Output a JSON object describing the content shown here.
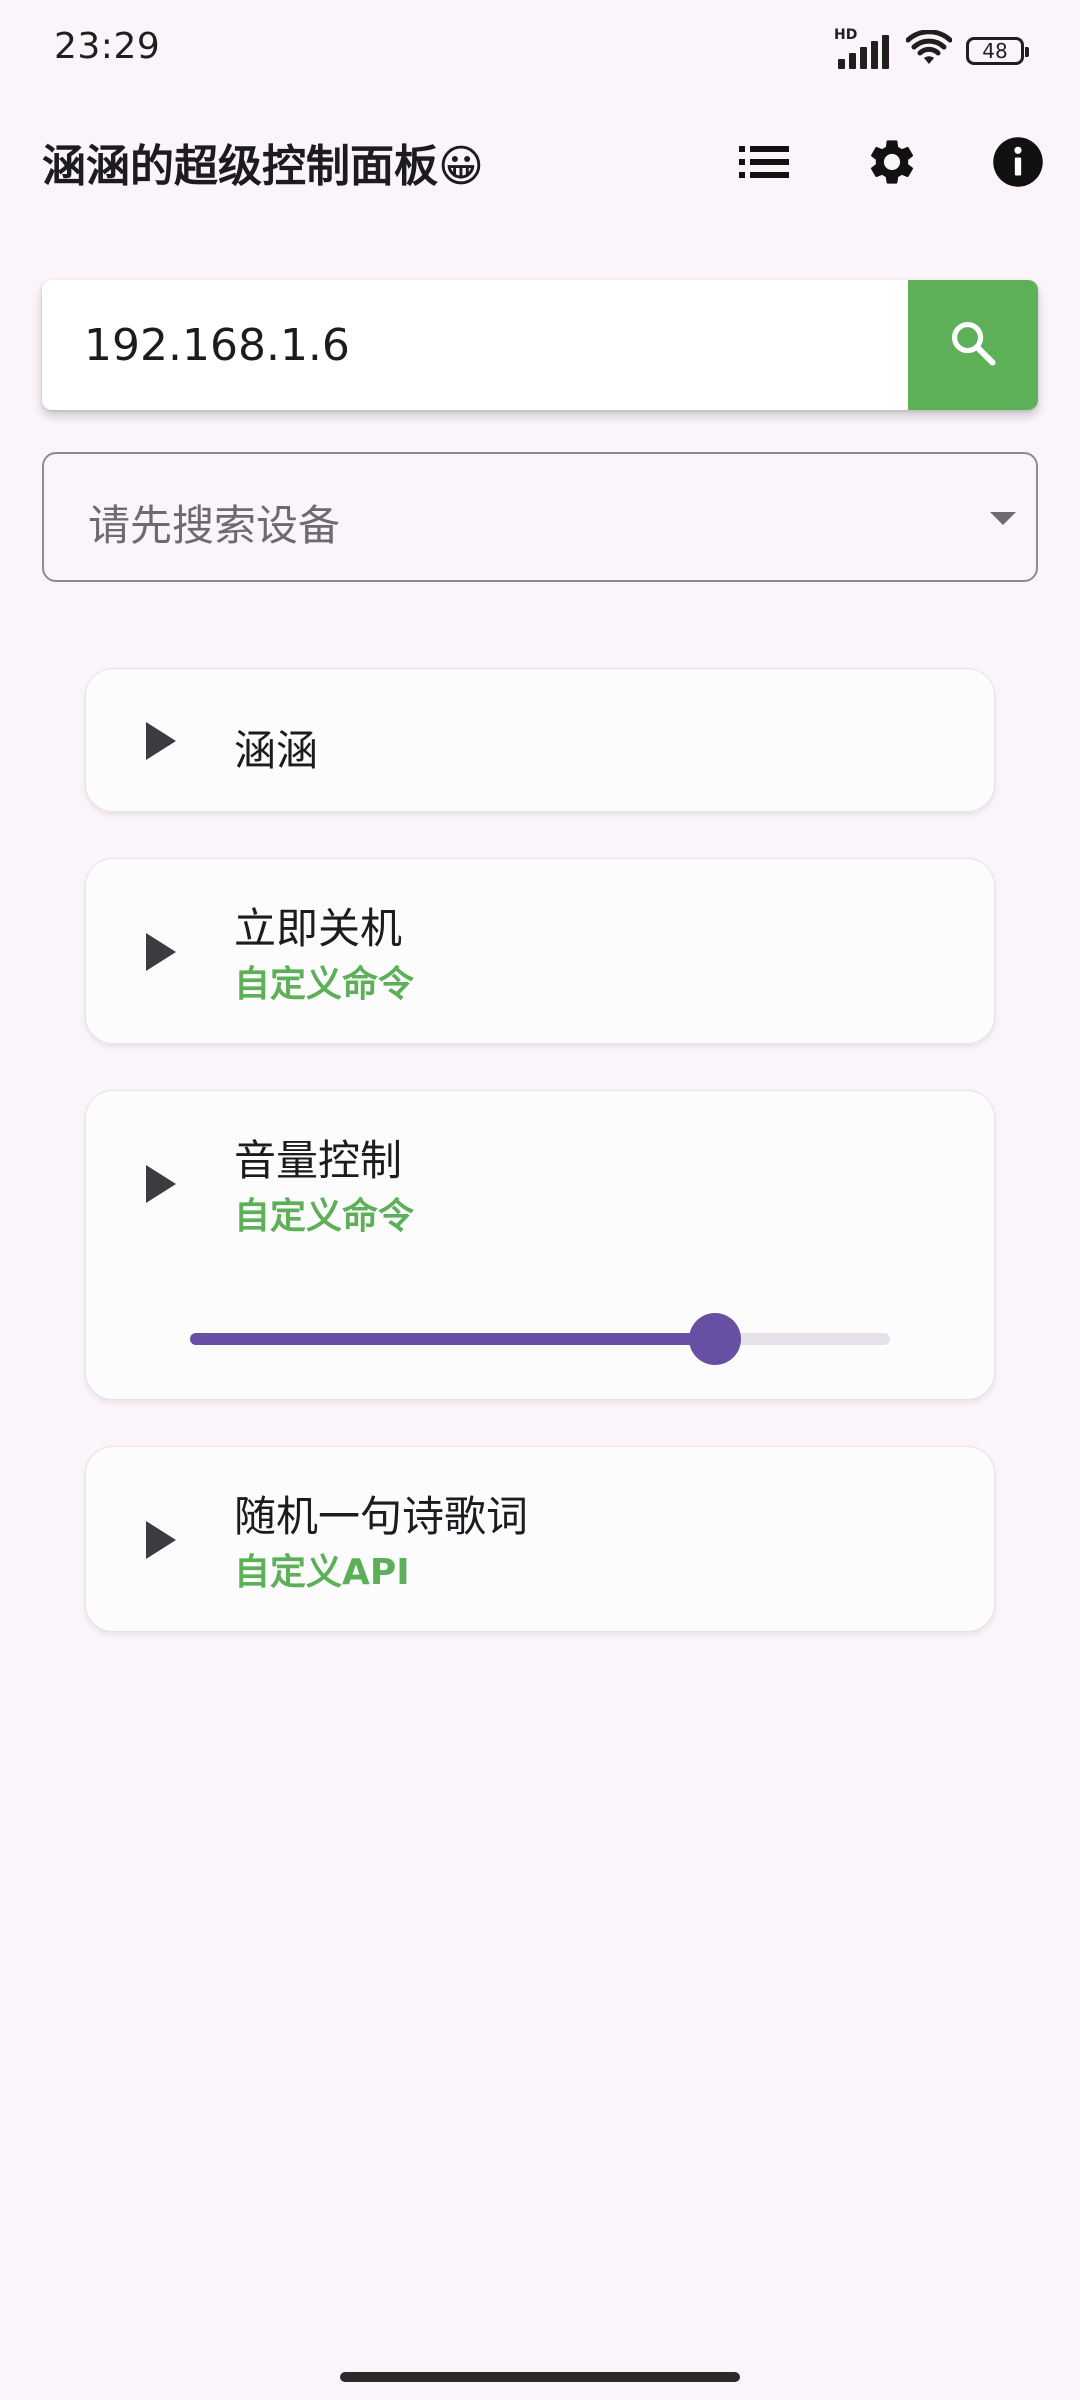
{
  "status_bar": {
    "time": "23:29",
    "network_label": "HD",
    "battery_level": "48"
  },
  "app_bar": {
    "title": "涵涵的超级控制面板😀",
    "actions": [
      "list-icon",
      "gear-icon",
      "info-icon"
    ]
  },
  "search": {
    "value": "192.168.1.6",
    "button_icon": "search-icon",
    "button_color": "#5daf58"
  },
  "device_select": {
    "placeholder": "请先搜索设备"
  },
  "commands": [
    {
      "title": "涵涵",
      "subtitle": ""
    },
    {
      "title": "立即关机",
      "subtitle": "自定义命令"
    },
    {
      "title": "音量控制",
      "subtitle": "自定义命令",
      "slider_value": 0.75
    },
    {
      "title": "随机一句诗歌词",
      "subtitle": "自定义API"
    }
  ],
  "colors": {
    "accent": "#6750a4",
    "success": "#5daf58",
    "background": "#fbf5fb"
  }
}
